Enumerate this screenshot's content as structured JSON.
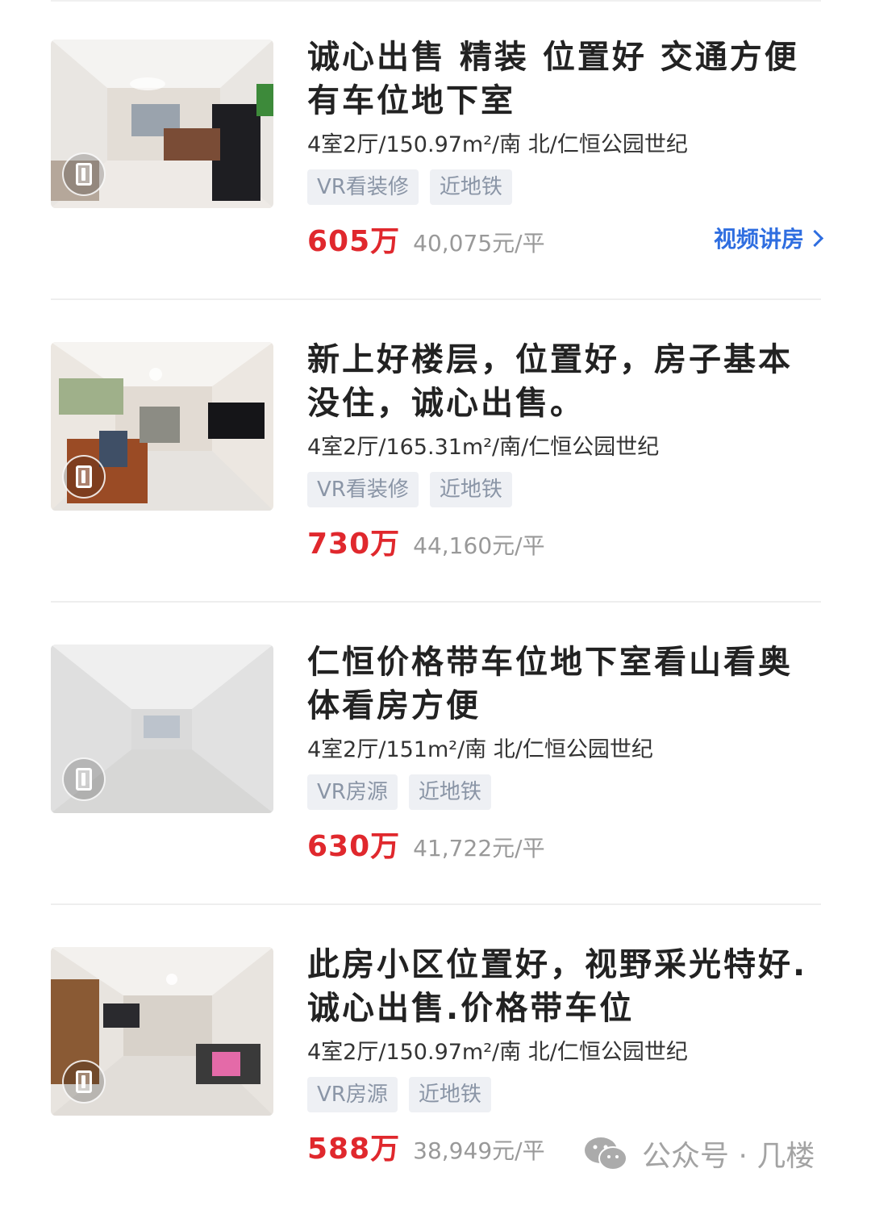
{
  "listings": [
    {
      "title": "诚心出售 精装 位置好 交通方便 有车位地下室",
      "meta": "4室2厅/150.97m²/南 北/仁恒公园世纪",
      "tags": [
        "VR看装修",
        "近地铁"
      ],
      "price": "605万",
      "unit_price": "40,075元/平",
      "video_link": "视频讲房",
      "thumbnail_icon": "vr-badge-icon"
    },
    {
      "title": "新上好楼层，位置好，房子基本没住，诚心出售。",
      "meta": "4室2厅/165.31m²/南/仁恒公园世纪",
      "tags": [
        "VR看装修",
        "近地铁"
      ],
      "price": "730万",
      "unit_price": "44,160元/平",
      "thumbnail_icon": "vr-badge-icon"
    },
    {
      "title": "仁恒价格带车位地下室看山看奥体看房方便",
      "meta": "4室2厅/151m²/南 北/仁恒公园世纪",
      "tags": [
        "VR房源",
        "近地铁"
      ],
      "price": "630万",
      "unit_price": "41,722元/平",
      "thumbnail_icon": "vr-badge-icon"
    },
    {
      "title": "此房小区位置好，视野采光特好.诚心出售.价格带车位",
      "meta": "4室2厅/150.97m²/南 北/仁恒公园世纪",
      "tags": [
        "VR房源",
        "近地铁"
      ],
      "price": "588万",
      "unit_price": "38,949元/平",
      "thumbnail_icon": "vr-badge-icon"
    }
  ],
  "watermark": {
    "text": "公众号 · 几楼",
    "icon": "wechat-icon"
  },
  "colors": {
    "price": "#e0282d",
    "link": "#2f6ee0",
    "tag_bg": "#eef0f4",
    "tag_text": "#8a95a6"
  }
}
